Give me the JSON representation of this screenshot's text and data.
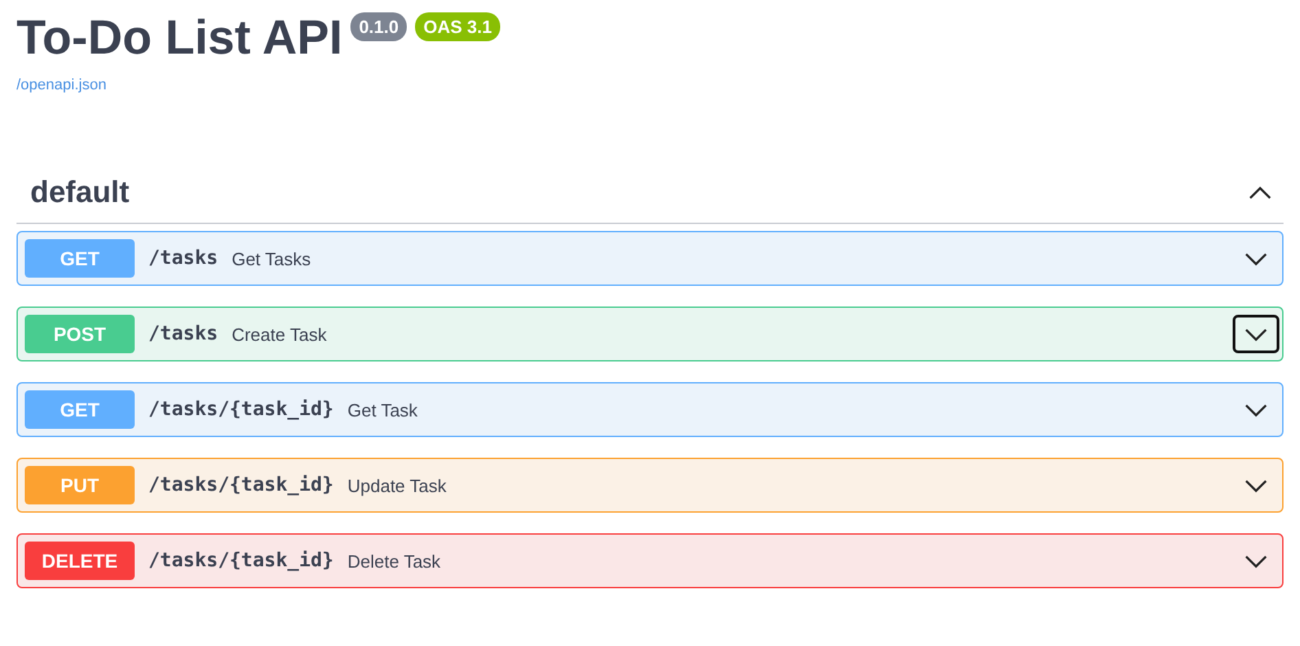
{
  "title": "To-Do List API",
  "version": "0.1.0",
  "oas": "OAS 3.1",
  "spec_link": "/openapi.json",
  "section": {
    "name": "default",
    "expanded": true
  },
  "operations": [
    {
      "kind": "get",
      "method": "GET",
      "path": "/tasks",
      "summary": "Get Tasks",
      "expanded": false,
      "focused": false
    },
    {
      "kind": "post",
      "method": "POST",
      "path": "/tasks",
      "summary": "Create Task",
      "expanded": false,
      "focused": true
    },
    {
      "kind": "get",
      "method": "GET",
      "path": "/tasks/{task_id}",
      "summary": "Get Task",
      "expanded": false,
      "focused": false
    },
    {
      "kind": "put",
      "method": "PUT",
      "path": "/tasks/{task_id}",
      "summary": "Update Task",
      "expanded": false,
      "focused": false
    },
    {
      "kind": "delete",
      "method": "DELETE",
      "path": "/tasks/{task_id}",
      "summary": "Delete Task",
      "expanded": false,
      "focused": false
    }
  ]
}
